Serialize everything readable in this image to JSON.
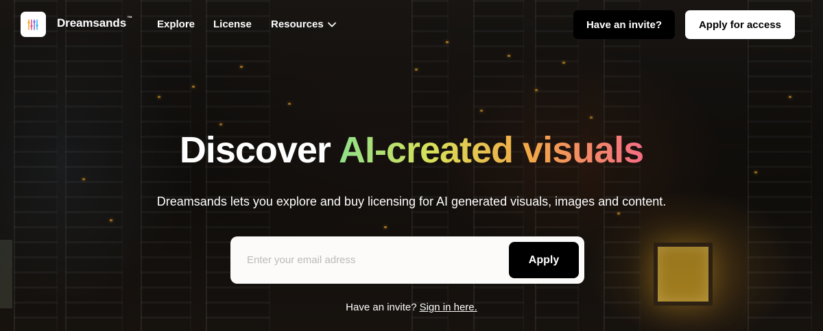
{
  "brand": {
    "name": "Dreamsands",
    "trademark": "™",
    "logo_icon": "equalizer-icon"
  },
  "nav": {
    "links": [
      "Explore",
      "License",
      "Resources"
    ],
    "resources_icon": "chevron-down-icon"
  },
  "header_actions": {
    "invite_label": "Have an invite?",
    "apply_access_label": "Apply for access"
  },
  "hero": {
    "title_plain": "Discover",
    "title_gradient": "AI-created visuals",
    "subtitle": "Dreamsands lets you explore and buy licensing for AI generated visuals, images and content.",
    "email_placeholder": "Enter your email adress",
    "apply_label": "Apply",
    "invite_prompt": "Have an invite?",
    "signin_link": "Sign in here."
  },
  "colors": {
    "gradient": [
      "#8fe08a",
      "#d7e05a",
      "#f2a847",
      "#f56d84"
    ],
    "button_dark": "#000000",
    "button_light": "#ffffff"
  }
}
